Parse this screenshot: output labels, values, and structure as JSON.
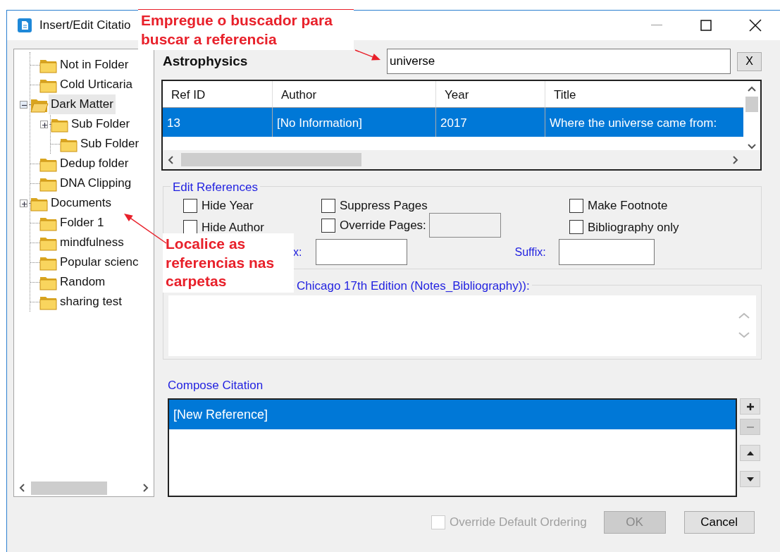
{
  "window": {
    "title": "Insert/Edit Citatio"
  },
  "folder_tree": [
    {
      "label": "Not in Folder",
      "selected": false
    },
    {
      "label": "Cold Urticaria",
      "selected": false
    },
    {
      "label": "Dark Matter",
      "expanded": true,
      "selected": true,
      "children": [
        {
          "label": "Sub Folder",
          "expanded": false,
          "selected": false
        },
        {
          "label": "Sub Folder",
          "selected": false
        }
      ]
    },
    {
      "label": "Dedup folder",
      "selected": false
    },
    {
      "label": "DNA Clipping",
      "selected": false
    },
    {
      "label": "Documents",
      "expanded": false,
      "selected": false
    },
    {
      "label": "Folder 1",
      "selected": false
    },
    {
      "label": "mindfulness",
      "selected": false
    },
    {
      "label": "Popular scienc",
      "selected": false
    },
    {
      "label": "Random",
      "selected": false
    },
    {
      "label": "sharing test",
      "selected": false
    }
  ],
  "library_name": "Astrophysics",
  "search": {
    "value": "universe",
    "clear_button": "X"
  },
  "references_table": {
    "columns": [
      "Ref ID",
      "Author",
      "Year",
      "Title"
    ],
    "rows": [
      {
        "cells": [
          "13",
          "[No Information]",
          "2017",
          "Where the universe came from:"
        ],
        "selected": true
      }
    ]
  },
  "edit_references": {
    "legend": "Edit References",
    "options": [
      {
        "label": "Hide Year",
        "checked": false
      },
      {
        "label": "Suppress Pages",
        "checked": false
      },
      {
        "label": "Make Footnote",
        "checked": false
      },
      {
        "label": "Hide Author",
        "checked": false
      },
      {
        "label": "Override Pages:",
        "checked": false
      },
      {
        "label": "Bibliography only",
        "checked": false
      }
    ],
    "override_pages_field": {
      "disabled": true
    },
    "prefix_label": "x:",
    "suffix_label": "Suffix:"
  },
  "style_preview": {
    "legend": "Chicago 17th Edition (Notes_Bibliography)):"
  },
  "compose_citation": {
    "label": "Compose Citation",
    "items": [
      {
        "text": "[New Reference]",
        "selected": true
      }
    ],
    "side_buttons": [
      {
        "kind": "add",
        "disabled": false
      },
      {
        "kind": "remove",
        "disabled": true
      },
      {
        "kind": "up",
        "disabled": false
      },
      {
        "kind": "down",
        "disabled": false
      }
    ]
  },
  "override_ordering": {
    "label": "Override Default Ordering",
    "checked": false,
    "disabled": true
  },
  "buttons": [
    {
      "label": "OK",
      "disabled": true
    },
    {
      "label": "Cancel",
      "disabled": false
    }
  ],
  "annotations": [
    {
      "lines": [
        "Empregue o buscador para",
        "buscar a referencia"
      ]
    },
    {
      "lines": [
        "Localice as",
        "referencias nas",
        "carpetas"
      ]
    }
  ]
}
